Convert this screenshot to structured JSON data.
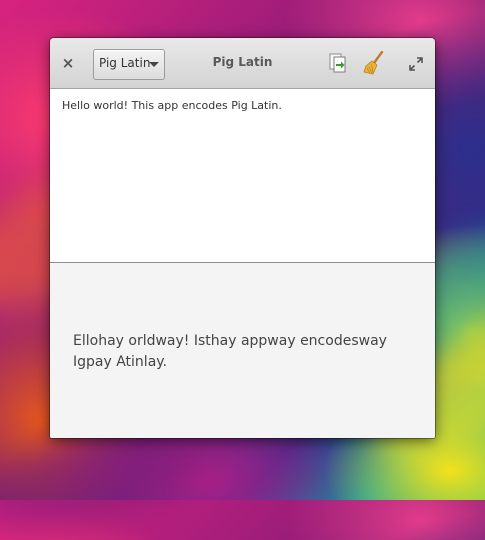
{
  "window": {
    "title": "Pig Latin",
    "language_combo": {
      "selected": "Pig Latin"
    },
    "close_glyph": "×",
    "buttons": {
      "close": "close-icon",
      "copy": "copy-icon",
      "clear": "broom-icon",
      "maximize": "maximize-icon"
    }
  },
  "input": {
    "text": "Hello world! This app encodes Pig Latin."
  },
  "output": {
    "text": "Ellohay orldway! Isthay appway encodesway Igpay Atinlay."
  },
  "colors": {
    "accent_copy_arrow": "#3c9a2b",
    "broom_handle": "#c47a2c",
    "broom_bristles": "#e8b33a"
  }
}
